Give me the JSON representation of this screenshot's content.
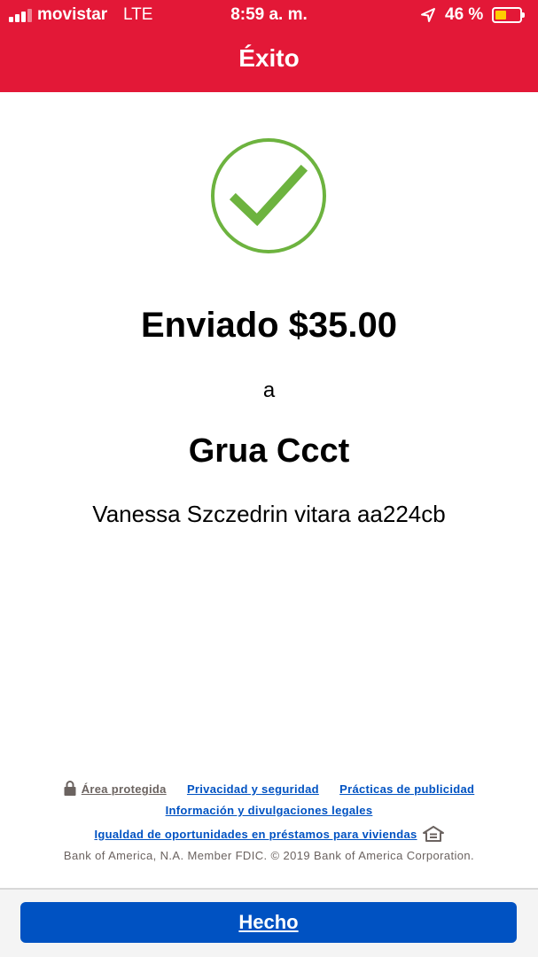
{
  "status_bar": {
    "carrier": "movistar",
    "network": "LTE",
    "time": "8:59 a. m.",
    "battery_percent": "46 %",
    "battery_level": 0.46,
    "icons": [
      "signal-icon",
      "location-icon",
      "battery-icon"
    ]
  },
  "header": {
    "title": "Éxito",
    "background_color": "#e31837"
  },
  "confirmation": {
    "icon": "check-circle-icon",
    "icon_color": "#6db33f",
    "amount_line": "Enviado $35.00",
    "to_word": "a",
    "recipient": "Grua Ccct",
    "memo": "Vanessa Szczedrin vitara aa224cb"
  },
  "footer": {
    "secure_area": "Área protegida",
    "privacy": "Privacidad y seguridad",
    "advertising": "Prácticas de publicidad",
    "legal_info": "Información y divulgaciones legales",
    "equal_housing": "Igualdad de oportunidades en préstamos para viviendas",
    "legal_text": "Bank of America, N.A. Member FDIC. © 2019 Bank of America Corporation."
  },
  "actions": {
    "done_label": "Hecho",
    "button_color": "#0052c2"
  }
}
